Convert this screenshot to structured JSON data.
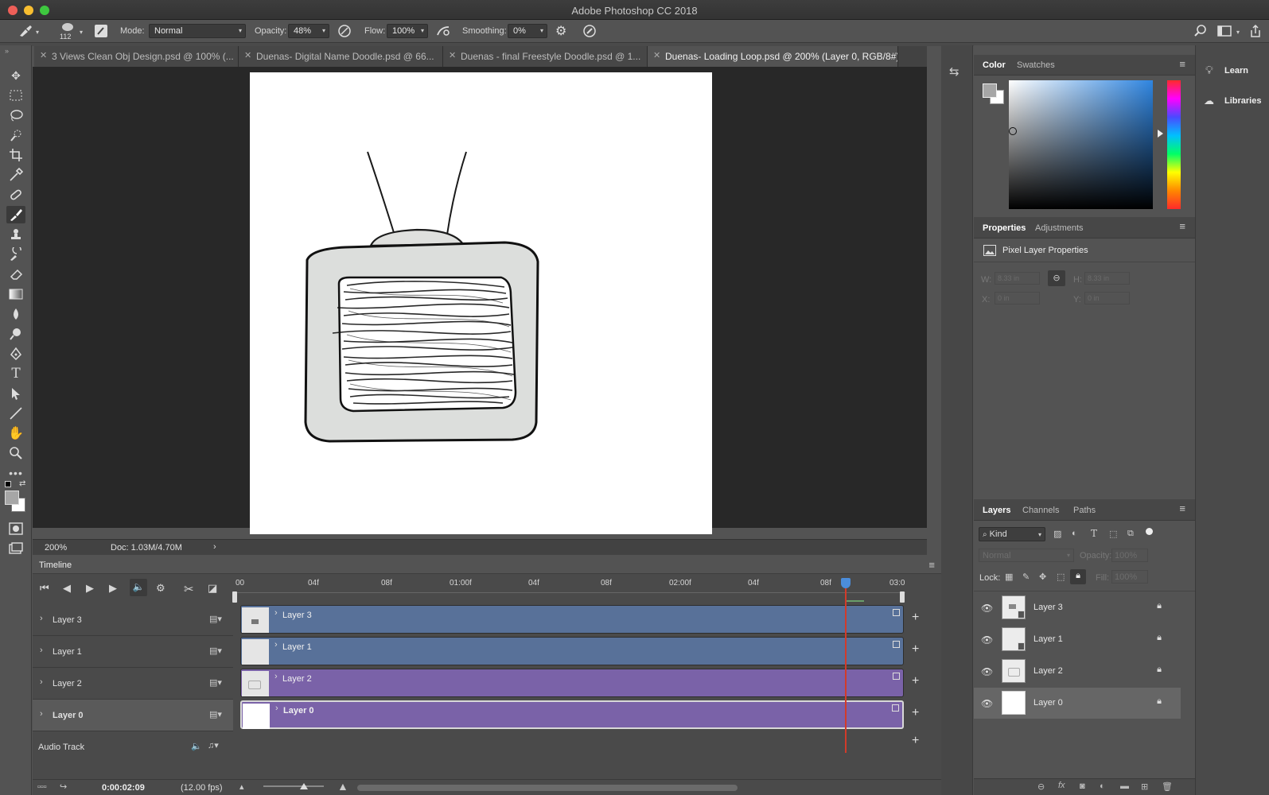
{
  "window": {
    "title": "Adobe Photoshop CC 2018"
  },
  "options_bar": {
    "brush_size": "112",
    "mode_label": "Mode:",
    "mode_value": "Normal",
    "opacity_label": "Opacity:",
    "opacity_value": "48%",
    "flow_label": "Flow:",
    "flow_value": "100%",
    "smoothing_label": "Smoothing:",
    "smoothing_value": "0%"
  },
  "tabs": [
    {
      "label": "3 Views Clean Obj Design.psd @ 100% (..."
    },
    {
      "label": "Duenas- Digital Name Doodle.psd @ 66..."
    },
    {
      "label": "Duenas - final Freestyle Doodle.psd @ 1..."
    },
    {
      "label": "Duenas- Loading Loop.psd @ 200% (Layer 0, RGB/8#)"
    }
  ],
  "status": {
    "zoom": "200%",
    "doc": "Doc: 1.03M/4.70M"
  },
  "timeline": {
    "title": "Timeline",
    "ruler": [
      "00",
      "04f",
      "08f",
      "01:00f",
      "04f",
      "08f",
      "02:00f",
      "04f",
      "08f",
      "03:0"
    ],
    "layers": [
      {
        "name": "Layer 3",
        "track": "Layer 3"
      },
      {
        "name": "Layer 1",
        "track": "Layer 1"
      },
      {
        "name": "Layer 2",
        "track": "Layer 2"
      },
      {
        "name": "Layer 0",
        "track": "Layer 0"
      }
    ],
    "audio_track": "Audio Track",
    "current_time": "0:00:02:09",
    "fps": "(12.00 fps)"
  },
  "color_panel": {
    "tab_color": "Color",
    "tab_swatches": "Swatches"
  },
  "properties_panel": {
    "tab_properties": "Properties",
    "tab_adjustments": "Adjustments",
    "heading": "Pixel Layer Properties",
    "w_label": "W:",
    "w_value": "8.33 in",
    "h_label": "H:",
    "h_value": "8.33 in",
    "x_label": "X:",
    "x_value": "0 in",
    "y_label": "Y:",
    "y_value": "0 in"
  },
  "layers_panel": {
    "tab_layers": "Layers",
    "tab_channels": "Channels",
    "tab_paths": "Paths",
    "filter_kind": "Kind",
    "blend_mode": "Normal",
    "opacity_label": "Opacity:",
    "opacity_value": "100%",
    "lock_label": "Lock:",
    "fill_label": "Fill:",
    "fill_value": "100%",
    "layers": [
      {
        "name": "Layer 3"
      },
      {
        "name": "Layer 1"
      },
      {
        "name": "Layer 2"
      },
      {
        "name": "Layer 0"
      }
    ]
  },
  "dock": {
    "learn": "Learn",
    "libraries": "Libraries"
  },
  "colors": {
    "track_blue": "#587199",
    "track_purple": "#7a62a8",
    "playhead": "#d23b2a",
    "panel_bg": "#535353",
    "canvas_bg": "#282828"
  }
}
